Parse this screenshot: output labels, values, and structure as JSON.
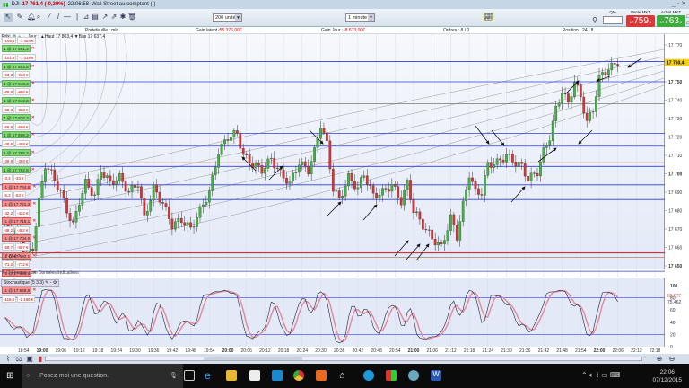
{
  "header": {
    "symbol": "DJI",
    "price_change": "17 761,4 (-0,39%)",
    "time": "22:06:58",
    "market": "Wall Street au comptant (-)"
  },
  "toolbar": {
    "quantity_select": "200 unités",
    "period_select": "1 minute",
    "qty_label": "Qté",
    "sell_label": "Vente MKT",
    "sell_prefix": "17",
    "sell_price": "759",
    "sell_suffix": ",5",
    "buy_label": "Achat MKT",
    "buy_prefix": "17",
    "buy_price": "763",
    "buy_suffix": ",5",
    "s_label": "S",
    "l_label": "L",
    "s_value": "10",
    "l_value": "10"
  },
  "info": {
    "portfolio": "Portefeuille : mld",
    "latent": "Gain latent :",
    "latent_value": "-55 376,00€",
    "day": "Gain Jour :",
    "day_value": "-8 673,00€",
    "orders": "Ordres : 8 / 0",
    "position": "Position : 24 / 8"
  },
  "chart_header": {
    "panel": "Prix",
    "range": "Jour : ▲Haut 17 803,4 ▼Bas 17 637,4"
  },
  "orders": [
    {
      "label": "",
      "pl": "-105,4",
      "eur": "-1 054 €"
    },
    {
      "label": "1 @ 17 861,3",
      "side": "buy",
      "pl": "-101,8",
      "eur": "-1 018 €"
    },
    {
      "label": "1 @ 17 853,8",
      "side": "buy",
      "pl": "-93,3",
      "eur": "-933 €"
    },
    {
      "label": "1 @ 17 849,3",
      "side": "buy",
      "pl": "-88,8",
      "eur": "-888 €"
    },
    {
      "label": "1 @ 17 842,8",
      "side": "buy",
      "pl": "-83,3",
      "eur": "-833 €"
    },
    {
      "label": "1 @ 17 828,3",
      "side": "buy",
      "pl": "-68,8",
      "eur": "-688 €"
    },
    {
      "label": "1 @ 17 808,3",
      "side": "buy",
      "pl": "-48,8",
      "eur": "-488 €"
    },
    {
      "label": "1 @ 17 796,3",
      "side": "buy",
      "pl": "-36,8",
      "eur": "-368 €"
    },
    {
      "label": "1 @ 17 762,8",
      "side": "buy",
      "pl": "-3,3",
      "eur": "-33 €"
    },
    {
      "label": "-1 @ 17 764,8",
      "side": "sell",
      "pl": "-5,3",
      "eur": "-53 €"
    },
    {
      "label": "-1 @ 17 721,3",
      "side": "sell",
      "pl": "-42,2",
      "eur": "-422 €"
    },
    {
      "label": "-1 @ 17 715,1",
      "side": "sell",
      "pl": "-48,2",
      "eur": "-482 €"
    },
    {
      "label": "-1 @ 17 704,6",
      "side": "sell",
      "pl": "-58,7",
      "eur": "-587 €"
    },
    {
      "label": "-1 @ 17 692,1",
      "side": "sell",
      "pl": "-71,2",
      "eur": "-712 €"
    },
    {
      "label": "-1 @ 17 685,1",
      "side": "sell",
      "pl": "-78,2",
      "eur": "-782 €"
    },
    {
      "label": "-1 @ 17 646,8",
      "side": "sell",
      "pl": "-116,6",
      "eur": "-1 166 €"
    }
  ],
  "stop_label": "17 654,7",
  "credit": "© IT-Finance.com Données indicatives",
  "stochastic": {
    "label": "Stochastique (5 3 3)",
    "k_value": "85,577",
    "d_value": "75,462"
  },
  "last_price_label": "17 760,4",
  "colors": {
    "up": "#3cb83c",
    "down": "#e03030",
    "sell": "#d83a3a",
    "buy": "#3eab3e"
  },
  "chart_data": {
    "type": "candlestick",
    "price_axis": {
      "min": 17646,
      "max": 17772,
      "ticks": [
        17770,
        17760,
        17750,
        17740,
        17730,
        17720,
        17710,
        17700,
        17690,
        17680,
        17670,
        17660,
        17650
      ],
      "tick_labels": [
        "17 770",
        "17 760",
        "17 750",
        "17 740",
        "17 730",
        "17 720",
        "17 710",
        "17 700",
        "17 690",
        "17 680",
        "17 670",
        "17 660",
        "17 650"
      ]
    },
    "stoch_axis": {
      "ticks": [
        100,
        80,
        60,
        40,
        20,
        0
      ],
      "tick_labels": [
        "100",
        "80",
        "60",
        "40",
        "20",
        "0"
      ]
    },
    "time_ticks": [
      "18:54",
      "19:00",
      "19:06",
      "19:12",
      "19:18",
      "19:24",
      "19:30",
      "19:36",
      "19:42",
      "19:48",
      "19:54",
      "20:00",
      "20:06",
      "20:12",
      "20:18",
      "20:24",
      "20:30",
      "20:36",
      "20:42",
      "20:48",
      "20:54",
      "21:00",
      "21:06",
      "21:12",
      "21:18",
      "21:24",
      "21:30",
      "21:36",
      "21:42",
      "21:48",
      "21:54",
      "22:00",
      "22:06",
      "22:12",
      "22:18"
    ],
    "closes": [
      [
        "18:48",
        17672
      ],
      [
        "18:52",
        17668
      ],
      [
        "18:55",
        17655
      ],
      [
        "18:57",
        17660
      ],
      [
        "18:59",
        17685
      ],
      [
        "19:01",
        17705
      ],
      [
        "19:03",
        17700
      ],
      [
        "19:06",
        17690
      ],
      [
        "19:08",
        17680
      ],
      [
        "19:10",
        17672
      ],
      [
        "19:12",
        17685
      ],
      [
        "19:14",
        17695
      ],
      [
        "19:17",
        17688
      ],
      [
        "19:19",
        17702
      ],
      [
        "19:22",
        17695
      ],
      [
        "19:25",
        17698
      ],
      [
        "19:28",
        17690
      ],
      [
        "19:31",
        17695
      ],
      [
        "19:33",
        17676
      ],
      [
        "19:36",
        17692
      ],
      [
        "19:39",
        17684
      ],
      [
        "19:42",
        17672
      ],
      [
        "19:45",
        17675
      ],
      [
        "19:48",
        17670
      ],
      [
        "19:51",
        17680
      ],
      [
        "19:54",
        17690
      ],
      [
        "19:57",
        17712
      ],
      [
        "20:00",
        17720
      ],
      [
        "20:03",
        17722
      ],
      [
        "20:05",
        17710
      ],
      [
        "20:08",
        17705
      ],
      [
        "20:11",
        17702
      ],
      [
        "20:14",
        17708
      ],
      [
        "20:17",
        17700
      ],
      [
        "20:20",
        17695
      ],
      [
        "20:23",
        17706
      ],
      [
        "20:26",
        17702
      ],
      [
        "20:28",
        17712
      ],
      [
        "20:30",
        17727
      ],
      [
        "20:32",
        17716
      ],
      [
        "20:34",
        17692
      ],
      [
        "20:36",
        17686
      ],
      [
        "20:39",
        17698
      ],
      [
        "20:42",
        17692
      ],
      [
        "20:44",
        17700
      ],
      [
        "20:47",
        17688
      ],
      [
        "20:50",
        17690
      ],
      [
        "20:53",
        17694
      ],
      [
        "20:56",
        17685
      ],
      [
        "20:58",
        17695
      ],
      [
        "21:00",
        17680
      ],
      [
        "21:03",
        17672
      ],
      [
        "21:06",
        17665
      ],
      [
        "21:09",
        17660
      ],
      [
        "21:12",
        17676
      ],
      [
        "21:14",
        17666
      ],
      [
        "21:16",
        17683
      ],
      [
        "21:18",
        17700
      ],
      [
        "21:20",
        17690
      ],
      [
        "21:22",
        17690
      ],
      [
        "21:24",
        17705
      ],
      [
        "21:27",
        17706
      ],
      [
        "21:30",
        17710
      ],
      [
        "21:33",
        17706
      ],
      [
        "21:35",
        17704
      ],
      [
        "21:37",
        17697
      ],
      [
        "21:40",
        17701
      ],
      [
        "21:42",
        17712
      ],
      [
        "21:44",
        17720
      ],
      [
        "21:46",
        17735
      ],
      [
        "21:48",
        17745
      ],
      [
        "21:50",
        17738
      ],
      [
        "21:52",
        17750
      ],
      [
        "21:54",
        17742
      ],
      [
        "21:56",
        17728
      ],
      [
        "21:58",
        17735
      ],
      [
        "22:00",
        17752
      ],
      [
        "22:02",
        17756
      ],
      [
        "22:04",
        17758
      ],
      [
        "22:06",
        17761
      ]
    ],
    "levels": [
      {
        "price": 17761,
        "color": "#2a3de0"
      },
      {
        "price": 17750,
        "color": "#2a3de0"
      },
      {
        "price": 17738,
        "color": "#777"
      },
      {
        "price": 17722,
        "color": "#2a3de0"
      },
      {
        "price": 17715,
        "color": "#2a3de0"
      },
      {
        "price": 17706,
        "color": "#b0806a"
      },
      {
        "price": 17704,
        "color": "#2a3de0"
      },
      {
        "price": 17694,
        "color": "#2a3de0"
      },
      {
        "price": 17686,
        "color": "#2a3de0"
      },
      {
        "price": 17657,
        "color": "#e01010"
      },
      {
        "price": 17654.7,
        "color": "#b0806a"
      },
      {
        "price": 17647,
        "color": "#2a3de0"
      }
    ]
  },
  "taskbar": {
    "search_placeholder": "Posez-moi une question.",
    "time": "22:06",
    "date": "07/12/2015"
  }
}
